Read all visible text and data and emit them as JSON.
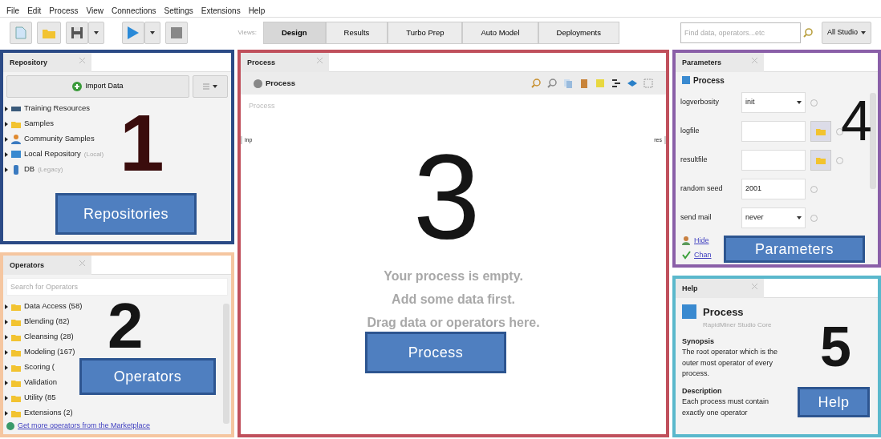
{
  "menu": [
    "File",
    "Edit",
    "Process",
    "View",
    "Connections",
    "Settings",
    "Extensions",
    "Help"
  ],
  "views": {
    "label": "Views:",
    "tabs": [
      {
        "label": "Design",
        "selected": true
      },
      {
        "label": "Results",
        "selected": false
      },
      {
        "label": "Turbo Prep",
        "selected": false
      },
      {
        "label": "Auto Model",
        "selected": false
      },
      {
        "label": "Deployments",
        "selected": false
      }
    ]
  },
  "search": {
    "placeholder": "Find data, operators...etc",
    "scope": "All Studio"
  },
  "repository": {
    "title": "Repository",
    "import_button": "Import Data",
    "items": [
      {
        "name": "Training Resources",
        "expanded": false
      },
      {
        "name": "Samples",
        "expanded": false
      },
      {
        "name": "Community Samples",
        "expanded": false
      },
      {
        "name": "Local Repository",
        "note": "(Local)",
        "expanded": false
      },
      {
        "name": "DB",
        "note": "(Legacy)",
        "expanded": false
      }
    ]
  },
  "operators": {
    "title": "Operators",
    "placeholder": "Search for Operators",
    "items": [
      {
        "name": "Data Access (58)",
        "expanded": false
      },
      {
        "name": "Blending (82)",
        "expanded": false
      },
      {
        "name": "Cleansing (28)",
        "expanded": false
      },
      {
        "name": "Modeling (167)",
        "expanded": false
      },
      {
        "name": "Scoring (",
        "expanded": false
      },
      {
        "name": "Validation",
        "expanded": false
      },
      {
        "name": "Utility (85",
        "expanded": false
      },
      {
        "name": "Extensions (2)",
        "expanded": false
      }
    ],
    "marketplace_link": "Get more operators from the Marketplace"
  },
  "process": {
    "tab": "Process",
    "breadcrumb": "Process",
    "canvas_label": "Process",
    "input_port": "inp",
    "result_port": "res",
    "empty_message": [
      "Your process is empty.",
      "Add some data first.",
      "Drag data or operators here."
    ]
  },
  "parameters": {
    "title": "Parameters",
    "operator": "Process",
    "rows": [
      {
        "kind": "select",
        "label": "logverbosity",
        "value": "init"
      },
      {
        "kind": "file",
        "label": "logfile"
      },
      {
        "kind": "file",
        "label": "resultfile"
      },
      {
        "kind": "text",
        "label": "random seed",
        "value": "2001"
      },
      {
        "kind": "select",
        "label": "send mail",
        "value": "never"
      }
    ],
    "links": [
      "Hide",
      "Chan"
    ]
  },
  "help": {
    "title": "Help",
    "operator": "Process",
    "group": "RapidMiner Studio Core",
    "sections": [
      {
        "heading": "Synopsis",
        "text": "The root operator which is the outer most operator of every process."
      },
      {
        "heading": "Description",
        "text": "Each process must contain exactly one operator"
      }
    ]
  },
  "annotations": [
    {
      "number": "1",
      "label": "Repositories",
      "color": "#2b4a86"
    },
    {
      "number": "2",
      "label": "Operators",
      "color": "#f5c6a0"
    },
    {
      "number": "3",
      "label": "Process",
      "color": "#c0505c"
    },
    {
      "number": "4",
      "label": "Parameters",
      "color": "#8a5fa8"
    },
    {
      "number": "5",
      "label": "Help",
      "color": "#5ab8cc"
    }
  ]
}
